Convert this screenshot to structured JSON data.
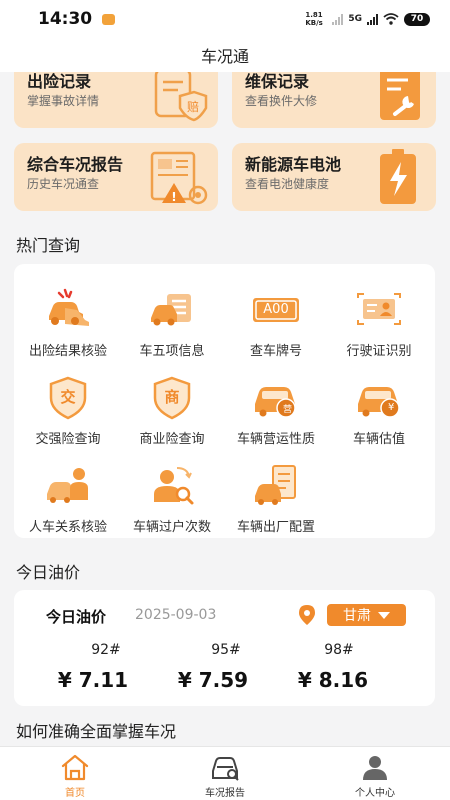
{
  "status_bar": {
    "time": "14:30",
    "net_speed": "1.81 KB/s",
    "network": "5G",
    "battery": "70"
  },
  "nav": {
    "title": "车况通"
  },
  "feature_cards": [
    {
      "title": "出险记录",
      "subtitle": "掌握事故详情",
      "icon": "claim-document-icon"
    },
    {
      "title": "维保记录",
      "subtitle": "查看换件大修",
      "icon": "maintenance-wrench-icon"
    },
    {
      "title": "综合车况报告",
      "subtitle": "历史车况通查",
      "icon": "report-warning-icon"
    },
    {
      "title": "新能源车电池",
      "subtitle": "查看电池健康度",
      "icon": "battery-bolt-icon"
    }
  ],
  "hot": {
    "title": "热门查询",
    "items": [
      {
        "label": "出险结果核验",
        "icon": "car-crash-icon"
      },
      {
        "label": "车五项信息",
        "icon": "car-info-icon"
      },
      {
        "label": "查车牌号",
        "icon": "license-plate-icon",
        "plate_text": "A00"
      },
      {
        "label": "行驶证识别",
        "icon": "id-card-icon"
      },
      {
        "label": "交强险查询",
        "icon": "compulsory-insurance-shield-icon",
        "badge_text": "交"
      },
      {
        "label": "商业险查询",
        "icon": "commercial-insurance-shield-icon",
        "badge_text": "商"
      },
      {
        "label": "车辆营运性质",
        "icon": "car-operation-icon",
        "badge_text": "营"
      },
      {
        "label": "车辆估值",
        "icon": "car-valuation-icon",
        "badge_text": "¥"
      },
      {
        "label": "人车关系核验",
        "icon": "person-car-icon"
      },
      {
        "label": "车辆过户次数",
        "icon": "transfer-count-icon"
      },
      {
        "label": "车辆出厂配置",
        "icon": "factory-config-icon"
      }
    ]
  },
  "oil": {
    "section_title": "今日油价",
    "card_title": "今日油价",
    "date": "2025-09-03",
    "region": "甘肃",
    "prices": [
      {
        "grade": "92#",
        "price": "¥ 7.11"
      },
      {
        "grade": "95#",
        "price": "¥ 7.59"
      },
      {
        "grade": "98#",
        "price": "¥ 8.16"
      }
    ]
  },
  "guide": {
    "title": "如何准确全面掌握车况"
  },
  "tabs": [
    {
      "label": "首页",
      "icon": "home-icon",
      "active": true
    },
    {
      "label": "车况报告",
      "icon": "car-report-icon",
      "active": false
    },
    {
      "label": "个人中心",
      "icon": "user-icon",
      "active": false
    }
  ],
  "colors": {
    "accent": "#f08a2c",
    "card_peach": "#fbe3c6",
    "background": "#f4f4f5"
  }
}
